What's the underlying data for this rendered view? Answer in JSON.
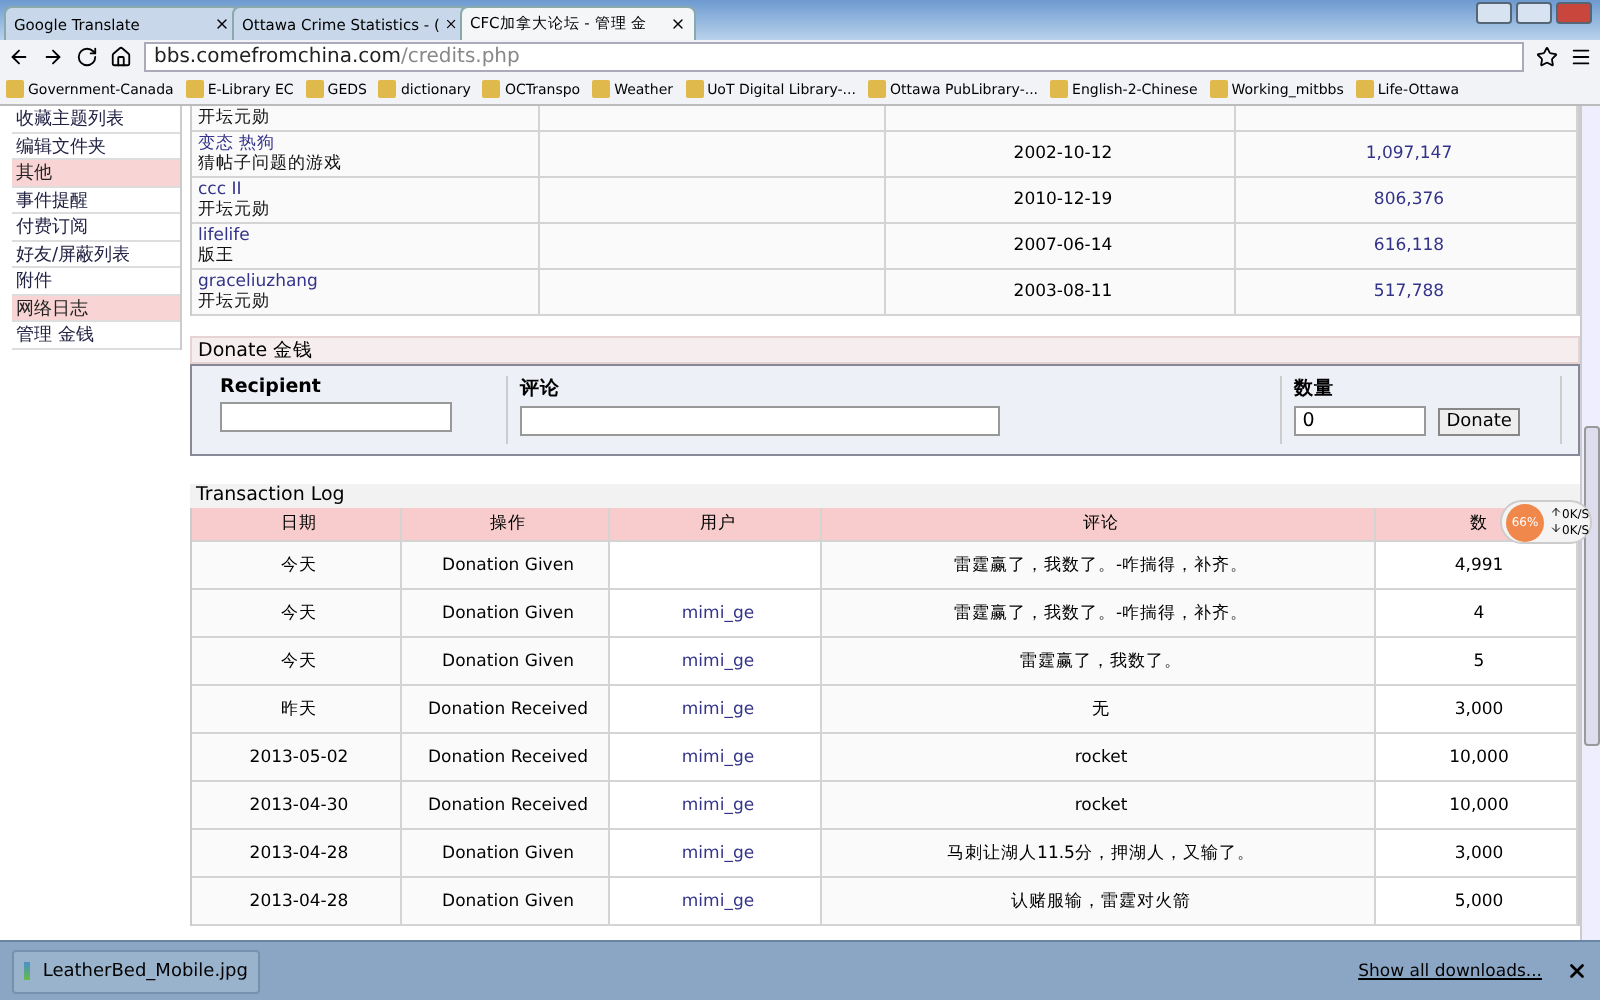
{
  "browser": {
    "tabs": [
      {
        "label": "Google Translate",
        "selected": false
      },
      {
        "label": "Ottawa Crime Statistics - (",
        "selected": false
      },
      {
        "label": "CFC加拿大论坛 - 管理 金",
        "selected": true
      }
    ],
    "url_host": "bbs.comefromchina.com",
    "url_path": "/credits.php",
    "bookmarks": [
      "Government-Canada",
      "E-Library EC",
      "GEDS",
      "dictionary",
      "OCTranspo",
      "Weather",
      "UoT Digital Library-...",
      "Ottawa PubLibrary-...",
      "English-2-Chinese",
      "Working_mitbbs",
      "Life-Ottawa"
    ]
  },
  "sidebar": {
    "items": [
      {
        "label": "收藏主题列表",
        "kind": "link"
      },
      {
        "label": "编辑文件夹",
        "kind": "link"
      },
      {
        "label": "其他",
        "kind": "section"
      },
      {
        "label": "事件提醒",
        "kind": "link"
      },
      {
        "label": "付费订阅",
        "kind": "link"
      },
      {
        "label": "好友/屏蔽列表",
        "kind": "link"
      },
      {
        "label": "附件",
        "kind": "link"
      },
      {
        "label": "网络日志",
        "kind": "section"
      },
      {
        "label": "管理 金钱",
        "kind": "link"
      }
    ]
  },
  "top_users": [
    {
      "title": "开坛元勋"
    },
    {
      "user": "变态 热狗",
      "title": "猜帖子问题的游戏",
      "date": "2002-10-12",
      "amount": "1,097,147"
    },
    {
      "user": "ccc II",
      "title": "开坛元勋",
      "date": "2010-12-19",
      "amount": "806,376"
    },
    {
      "user": "lifelife",
      "title": "版王",
      "date": "2007-06-14",
      "amount": "616,118"
    },
    {
      "user": "graceliuzhang",
      "title": "开坛元勋",
      "date": "2003-08-11",
      "amount": "517,788"
    }
  ],
  "donate": {
    "title": "Donate 金钱",
    "recipient_label": "Recipient",
    "comment_label": "评论",
    "amount_label": "数量",
    "amount_value": "0",
    "button": "Donate"
  },
  "transaction_log": {
    "title": "Transaction Log",
    "columns": [
      "日期",
      "操作",
      "用户",
      "评论",
      "数"
    ],
    "rows": [
      {
        "date": "今天",
        "action": "Donation Given",
        "comment": "雷霆赢了，我数了。-咋揣得，补齐。",
        "amount": "4,991"
      },
      {
        "date": "今天",
        "action": "Donation Given",
        "user": "mimi_ge",
        "comment": "雷霆赢了，我数了。-咋揣得，补齐。",
        "amount": "4"
      },
      {
        "date": "今天",
        "action": "Donation Given",
        "user": "mimi_ge",
        "comment": "雷霆赢了，我数了。",
        "amount": "5"
      },
      {
        "date": "昨天",
        "action": "Donation Received",
        "user": "mimi_ge",
        "comment": "无",
        "amount": "3,000"
      },
      {
        "date": "2013-05-02",
        "action": "Donation Received",
        "user": "mimi_ge",
        "comment": "rocket",
        "amount": "10,000"
      },
      {
        "date": "2013-04-30",
        "action": "Donation Received",
        "user": "mimi_ge",
        "comment": "rocket",
        "amount": "10,000"
      },
      {
        "date": "2013-04-28",
        "action": "Donation Given",
        "user": "mimi_ge",
        "comment": "马刺让湖人11.5分，押湖人，又输了。",
        "amount": "3,000"
      },
      {
        "date": "2013-04-28",
        "action": "Donation Given",
        "user": "mimi_ge",
        "comment": "认赌服输，雷霆对火箭",
        "amount": "5,000"
      }
    ]
  },
  "speed_widget": {
    "percent": "66%",
    "up": "0K/S",
    "down": "0K/S"
  },
  "download_bar": {
    "file": "LeatherBed_Mobile.jpg",
    "show_all": "Show all downloads..."
  }
}
